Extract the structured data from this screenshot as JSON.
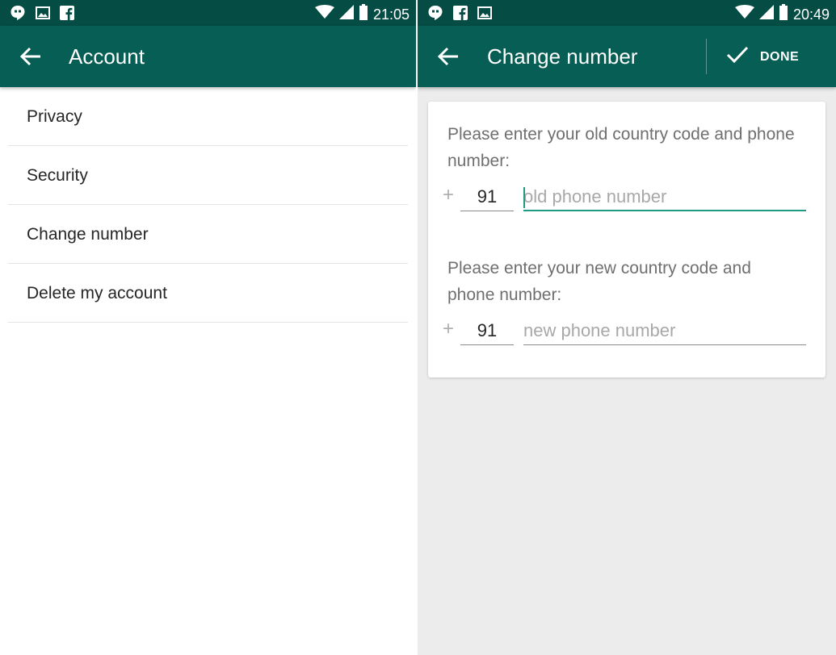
{
  "left_screen": {
    "status_bar": {
      "time": "21:05",
      "icons": [
        "hangouts-icon",
        "image-icon",
        "facebook-icon",
        "wifi-icon",
        "signal-icon",
        "battery-icon"
      ]
    },
    "app_bar": {
      "title": "Account",
      "back_icon": "arrow-left-icon"
    },
    "menu_items": [
      {
        "label": "Privacy"
      },
      {
        "label": "Security"
      },
      {
        "label": "Change number"
      },
      {
        "label": "Delete my account"
      }
    ]
  },
  "right_screen": {
    "status_bar": {
      "time": "20:49",
      "icons": [
        "hangouts-icon",
        "facebook-icon",
        "image-icon",
        "wifi-icon",
        "signal-icon",
        "battery-icon"
      ]
    },
    "app_bar": {
      "title": "Change number",
      "back_icon": "arrow-left-icon",
      "done_label": "DONE",
      "done_icon": "check-icon"
    },
    "old_number": {
      "prompt": "Please enter your old country code and phone number:",
      "plus": "+",
      "country_code": "91",
      "placeholder": "old phone number"
    },
    "new_number": {
      "prompt": "Please enter your new country code and phone number:",
      "plus": "+",
      "country_code": "91",
      "placeholder": "new phone number"
    }
  },
  "colors": {
    "status_bar": "#054d44",
    "app_bar": "#075e54",
    "accent": "#1f9a86",
    "content_bg": "#ececec"
  }
}
